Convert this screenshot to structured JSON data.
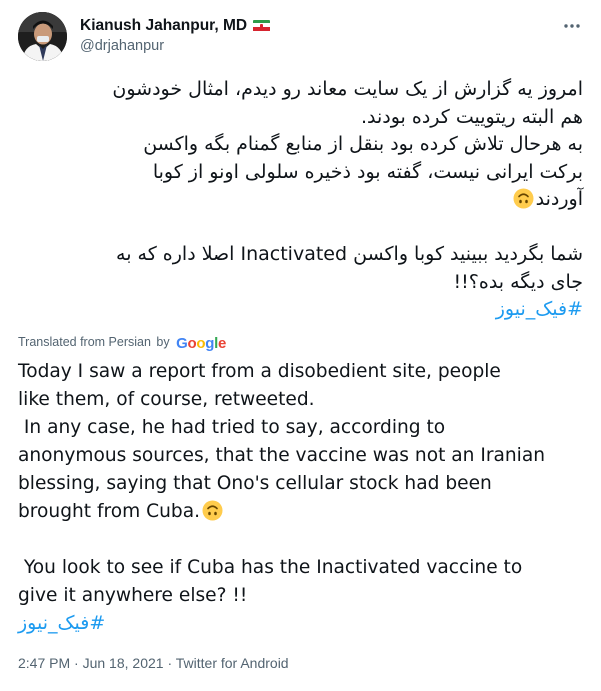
{
  "author": {
    "display_name": "Kianush Jahanpur, MD",
    "handle": "@drjahanpur",
    "flag": "iran-flag"
  },
  "tweet": {
    "persian_lines": [
      "امروز یه گزارش از یک سایت معاند رو دیدم، امثال خودشون",
      "هم البته ریتوییت کرده بودند.",
      "به هرحال تلاش کرده بود بنقل از منابع گمنام بگه واکسن",
      "برکت ایرانی نیست، گفته بود ذخیره سلولی اونو از کوبا",
      "آوردند"
    ],
    "persian_lines_2": [
      "شما بگردید ببینید کوبا واکسن Inactivated اصلا داره که به",
      "جای دیگه بده؟!!"
    ],
    "hashtag": "#فیک_نیوز",
    "emoji": "upside-down-face-emoji"
  },
  "translation": {
    "label": "Translated from Persian",
    "by": "by",
    "provider": "Google",
    "lines": [
      "Today I saw a report from a disobedient site, people",
      "like them, of course, retweeted.",
      " In any case, he had tried to say, according to",
      "anonymous sources, that the vaccine was not an Iranian",
      "blessing, saying that Ono's cellular stock had been",
      "brought from Cuba."
    ],
    "lines_2": [
      " You look to see if Cuba has the Inactivated vaccine to",
      "give it anywhere else? !!"
    ],
    "hashtag": "#فیک_نیوز"
  },
  "meta": {
    "time": "2:47 PM",
    "separator": "·",
    "date": "Jun 18, 2021",
    "source": "Twitter for Android"
  },
  "colors": {
    "link": "#1d9bf0",
    "secondary_text": "#536471",
    "primary_text": "#0f1419"
  }
}
